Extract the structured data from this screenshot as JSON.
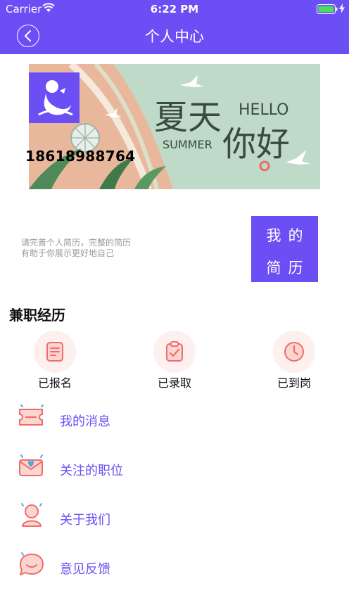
{
  "status_bar": {
    "carrier": "Carrier",
    "time": "6:22 PM"
  },
  "nav": {
    "title": "个人中心"
  },
  "banner": {
    "title_cn_1": "夏天",
    "title_cn_2": "你好",
    "hello": "HELLO",
    "summer": "SUMMER"
  },
  "profile": {
    "phone": "18618988764"
  },
  "resume": {
    "hint_line1": "请完善个人简历，完整的简历",
    "hint_line2": "有助于你展示更好地自己",
    "button_line1": "我的",
    "button_line2": "简历"
  },
  "section": {
    "title": "兼职经历"
  },
  "statuses": [
    {
      "label": "已报名",
      "icon": "form-icon"
    },
    {
      "label": "已录取",
      "icon": "clipboard-check-icon"
    },
    {
      "label": "已到岗",
      "icon": "clock-icon"
    }
  ],
  "menu": [
    {
      "label": "我的消息",
      "icon": "ticket-icon"
    },
    {
      "label": "关注的职位",
      "icon": "heart-envelope-icon"
    },
    {
      "label": "关于我们",
      "icon": "person-icon"
    },
    {
      "label": "意见反馈",
      "icon": "chat-bubble-icon"
    }
  ],
  "colors": {
    "accent": "#6C4EF5",
    "icon_red": "#F26B6B",
    "icon_bg": "#FDF0EE",
    "banner_green": "#BFDAC8",
    "banner_sand": "#E9B89C"
  }
}
